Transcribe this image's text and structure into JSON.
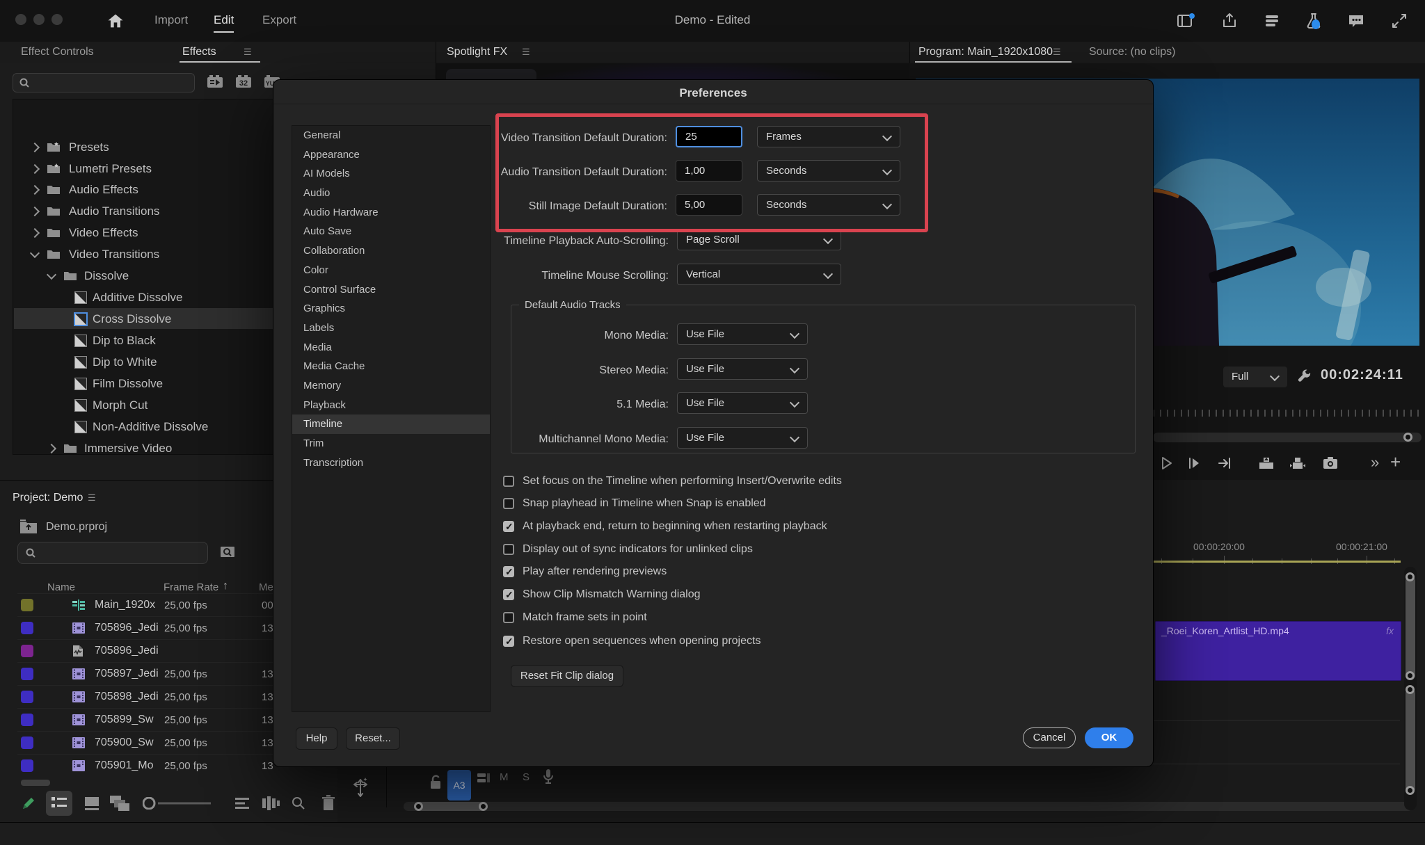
{
  "icons": {
    "panel_menu": "☰",
    "more_chevrons": "»",
    "add_plus": "+",
    "sort_up": "↑",
    "mute": "M",
    "solo": "S"
  },
  "topbar": {
    "import_label": "Import",
    "edit_label": "Edit",
    "export_label": "Export",
    "title": "Demo - Edited"
  },
  "effects": {
    "tab_controls": "Effect Controls",
    "tab_effects": "Effects",
    "tree": {
      "presets": "Presets",
      "lumetri": "Lumetri Presets",
      "audio_effects": "Audio Effects",
      "audio_transitions": "Audio Transitions",
      "video_effects": "Video Effects",
      "video_transitions": "Video Transitions",
      "dissolve": "Dissolve",
      "additive": "Additive Dissolve",
      "cross": "Cross Dissolve",
      "dip_black": "Dip to Black",
      "dip_white": "Dip to White",
      "film": "Film Dissolve",
      "morph": "Morph Cut",
      "non_additive": "Non-Additive Dissolve",
      "immersive": "Immersive Video"
    }
  },
  "spotlight": {
    "tab": "Spotlight FX"
  },
  "program": {
    "tab": "Program: Main_1920x1080",
    "source_tab": "Source: (no clips)",
    "zoom_level": "Full",
    "timecode": "00:02:24:11"
  },
  "project": {
    "tab": "Project: Demo",
    "file": "Demo.prproj",
    "columns": {
      "name": "Name",
      "frame_rate": "Frame Rate",
      "media": "Me"
    },
    "rows": [
      {
        "name": "Main_1920x",
        "fps": "25,00 fps",
        "m": "00"
      },
      {
        "name": "705896_Jedi",
        "fps": "25,00 fps",
        "m": "13"
      },
      {
        "name": "705896_Jedi",
        "fps": "",
        "m": ""
      },
      {
        "name": "705897_Jedi",
        "fps": "25,00 fps",
        "m": "13"
      },
      {
        "name": "705898_Jedi",
        "fps": "25,00 fps",
        "m": "13"
      },
      {
        "name": "705899_Sw",
        "fps": "25,00 fps",
        "m": "13"
      },
      {
        "name": "705900_Sw",
        "fps": "25,00 fps",
        "m": "13"
      },
      {
        "name": "705901_Mo",
        "fps": "25,00 fps",
        "m": "13"
      }
    ]
  },
  "dialog": {
    "title": "Preferences",
    "sidebar": [
      "General",
      "Appearance",
      "AI Models",
      "Audio",
      "Audio Hardware",
      "Auto Save",
      "Collaboration",
      "Color",
      "Control Surface",
      "Graphics",
      "Labels",
      "Media",
      "Media Cache",
      "Memory",
      "Playback",
      "Timeline",
      "Trim",
      "Transcription"
    ],
    "video_duration": {
      "label": "Video Transition Default Duration:",
      "value": "25",
      "unit": "Frames"
    },
    "audio_duration": {
      "label": "Audio Transition Default Duration:",
      "value": "1,00",
      "unit": "Seconds"
    },
    "still_duration": {
      "label": "Still Image Default Duration:",
      "value": "5,00",
      "unit": "Seconds"
    },
    "autoscroll": {
      "label": "Timeline Playback Auto-Scrolling:",
      "value": "Page Scroll"
    },
    "mouse_scroll": {
      "label": "Timeline Mouse Scrolling:",
      "value": "Vertical"
    },
    "audio_tracks": {
      "legend": "Default Audio Tracks",
      "mono": {
        "label": "Mono Media:",
        "value": "Use File"
      },
      "stereo": {
        "label": "Stereo Media:",
        "value": "Use File"
      },
      "five_one": {
        "label": "5.1 Media:",
        "value": "Use File"
      },
      "multichannel": {
        "label": "Multichannel Mono Media:",
        "value": "Use File"
      }
    },
    "checkboxes": [
      {
        "label": "Set focus on the Timeline when performing Insert/Overwrite edits",
        "checked": "false"
      },
      {
        "label": "Snap playhead in Timeline when Snap is enabled",
        "checked": "false"
      },
      {
        "label": "At playback end, return to beginning when restarting playback",
        "checked": "true"
      },
      {
        "label": "Display out of sync indicators for unlinked clips",
        "checked": "false"
      },
      {
        "label": "Play after rendering previews",
        "checked": "true"
      },
      {
        "label": "Show Clip Mismatch Warning dialog",
        "checked": "true"
      },
      {
        "label": "Match frame sets in point",
        "checked": "false"
      },
      {
        "label": "Restore open sequences when opening projects",
        "checked": "true"
      }
    ],
    "reset_fit_label": "Reset Fit Clip dialog",
    "help_label": "Help",
    "reset_label": "Reset...",
    "cancel_label": "Cancel",
    "ok_label": "OK"
  },
  "timeline": {
    "ruler_labels": [
      "00:00:20:00",
      "00:00:21:00"
    ],
    "clip": {
      "name": "_Roei_Koren_Artlist_HD.mp4",
      "fx_badge": "fx"
    },
    "track_button": "A3"
  },
  "colors": {
    "accent_blue": "#2f7feb",
    "highlight_red": "#d9434f",
    "clip_purple": "#3e21a0",
    "track_blue": "#2e66b8",
    "focus_blue": "#4f8fe0"
  }
}
